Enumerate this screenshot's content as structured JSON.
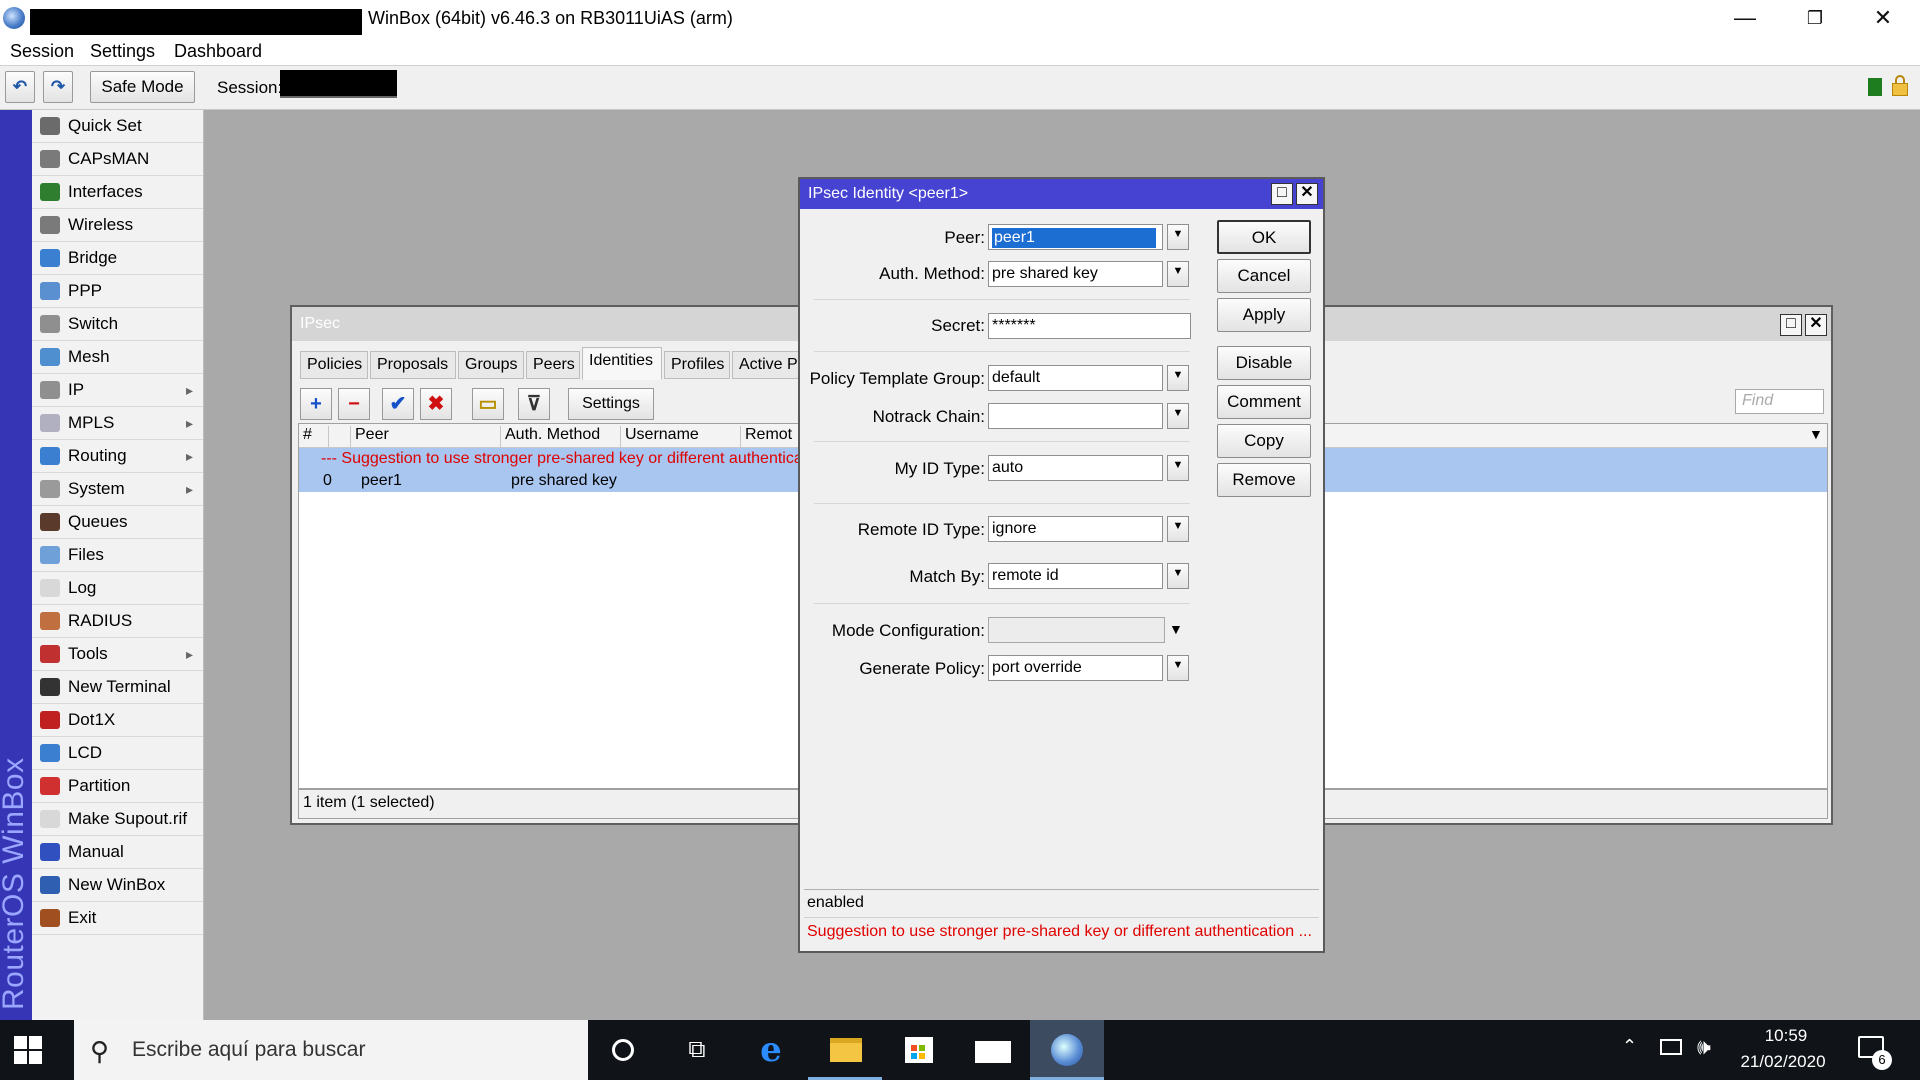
{
  "window": {
    "title": "WinBox (64bit) v6.46.3 on RB3011UiAS (arm)",
    "minimize": "—",
    "restore": "❐",
    "close": "✕"
  },
  "menu": [
    "Session",
    "Settings",
    "Dashboard"
  ],
  "toolbar": {
    "undo": "↶",
    "redo": "↷",
    "safe_mode": "Safe Mode",
    "session_label": "Session:"
  },
  "brand": "RouterOS WinBox",
  "sidebar": {
    "items": [
      {
        "label": "Quick Set",
        "icon": "quick-set-icon",
        "color": "#6b6b6b",
        "sub": false
      },
      {
        "label": "CAPsMAN",
        "icon": "capsman-icon",
        "color": "#7a7a7a",
        "sub": false
      },
      {
        "label": "Interfaces",
        "icon": "interfaces-icon",
        "color": "#2f7d2f",
        "sub": false
      },
      {
        "label": "Wireless",
        "icon": "wireless-icon",
        "color": "#7a7a7a",
        "sub": false
      },
      {
        "label": "Bridge",
        "icon": "bridge-icon",
        "color": "#3a7fd0",
        "sub": false
      },
      {
        "label": "PPP",
        "icon": "ppp-icon",
        "color": "#5a8fd0",
        "sub": false
      },
      {
        "label": "Switch",
        "icon": "switch-icon",
        "color": "#8f8f8f",
        "sub": false
      },
      {
        "label": "Mesh",
        "icon": "mesh-icon",
        "color": "#4f8fcf",
        "sub": false
      },
      {
        "label": "IP",
        "icon": "ip-icon",
        "color": "#8f8f8f",
        "sub": true,
        "arrow": "▸"
      },
      {
        "label": "MPLS",
        "icon": "mpls-icon",
        "color": "#b0b0c0",
        "sub": true,
        "arrow": "▸"
      },
      {
        "label": "Routing",
        "icon": "routing-icon",
        "color": "#3a7fd0",
        "sub": true,
        "arrow": "▸"
      },
      {
        "label": "System",
        "icon": "system-icon",
        "color": "#9a9a9a",
        "sub": true,
        "arrow": "▸"
      },
      {
        "label": "Queues",
        "icon": "queues-icon",
        "color": "#5a3a2a",
        "sub": false
      },
      {
        "label": "Files",
        "icon": "files-icon",
        "color": "#6fa0d8",
        "sub": false
      },
      {
        "label": "Log",
        "icon": "log-icon",
        "color": "#d8d8d8",
        "sub": false
      },
      {
        "label": "RADIUS",
        "icon": "radius-icon",
        "color": "#c07040",
        "sub": false
      },
      {
        "label": "Tools",
        "icon": "tools-icon",
        "color": "#c03030",
        "sub": true,
        "arrow": "▸"
      },
      {
        "label": "New Terminal",
        "icon": "terminal-icon",
        "color": "#333333",
        "sub": false
      },
      {
        "label": "Dot1X",
        "icon": "dot1x-icon",
        "color": "#c02020",
        "sub": false
      },
      {
        "label": "LCD",
        "icon": "lcd-icon",
        "color": "#3a7fd0",
        "sub": false
      },
      {
        "label": "Partition",
        "icon": "partition-icon",
        "color": "#d03030",
        "sub": false
      },
      {
        "label": "Make Supout.rif",
        "icon": "supout-icon",
        "color": "#d8d8d8",
        "sub": false
      },
      {
        "label": "Manual",
        "icon": "manual-icon",
        "color": "#3050c0",
        "sub": false
      },
      {
        "label": "New WinBox",
        "icon": "winbox-icon",
        "color": "#2f5fb0",
        "sub": false
      },
      {
        "label": "Exit",
        "icon": "exit-icon",
        "color": "#a05020",
        "sub": false
      }
    ]
  },
  "ipsec": {
    "title": "IPsec",
    "tabs": [
      "Policies",
      "Proposals",
      "Groups",
      "Peers",
      "Identities",
      "Profiles",
      "Active P"
    ],
    "active_tab": "Identities",
    "toolbar": {
      "add": "+",
      "remove": "−",
      "enable": "✔",
      "disable": "✖",
      "comment": "▭",
      "filter": "⊽",
      "settings": "Settings"
    },
    "find_placeholder": "Find",
    "columns": [
      "#",
      "Peer",
      "Auth. Method",
      "Username",
      "Remot"
    ],
    "comment_row": "--- Suggestion to use stronger pre-shared key or different authentica",
    "rows": [
      {
        "num": "0",
        "peer": "peer1",
        "auth": "pre shared key",
        "username": "",
        "remote": ""
      }
    ],
    "status": "1 item (1 selected)",
    "col_dropdown": "▼"
  },
  "identity": {
    "title": "IPsec Identity <peer1>",
    "fields": {
      "peer": {
        "label": "Peer:",
        "value": "peer1"
      },
      "auth_method": {
        "label": "Auth. Method:",
        "value": "pre shared key"
      },
      "secret": {
        "label": "Secret:",
        "value": "*******"
      },
      "policy_template_group": {
        "label": "Policy Template Group:",
        "value": "default"
      },
      "notrack_chain": {
        "label": "Notrack Chain:",
        "value": ""
      },
      "my_id_type": {
        "label": "My ID Type:",
        "value": "auto"
      },
      "remote_id_type": {
        "label": "Remote ID Type:",
        "value": "ignore"
      },
      "match_by": {
        "label": "Match By:",
        "value": "remote id"
      },
      "mode_configuration": {
        "label": "Mode Configuration:",
        "value": ""
      },
      "generate_policy": {
        "label": "Generate Policy:",
        "value": "port override"
      }
    },
    "dropdown_glyph": "▼",
    "buttons": {
      "ok": "OK",
      "cancel": "Cancel",
      "apply": "Apply",
      "disable": "Disable",
      "comment": "Comment",
      "copy": "Copy",
      "remove": "Remove"
    },
    "status": "enabled",
    "warning": "Suggestion to use stronger pre-shared key or different authentication ..."
  },
  "taskbar": {
    "search_placeholder": "Escribe aquí para buscar",
    "search_glyph": "⚲",
    "taskview_glyph": "⧉",
    "edge_glyph": "e",
    "tray_up": "⌃",
    "volume": "🕪",
    "time": "10:59",
    "date": "21/02/2020",
    "notifications": "6"
  },
  "colors": {
    "sidebar_brand": "#3535b5",
    "dialog_title": "#4642d2",
    "selection": "#a8c6ef",
    "warning": "#e00000"
  }
}
